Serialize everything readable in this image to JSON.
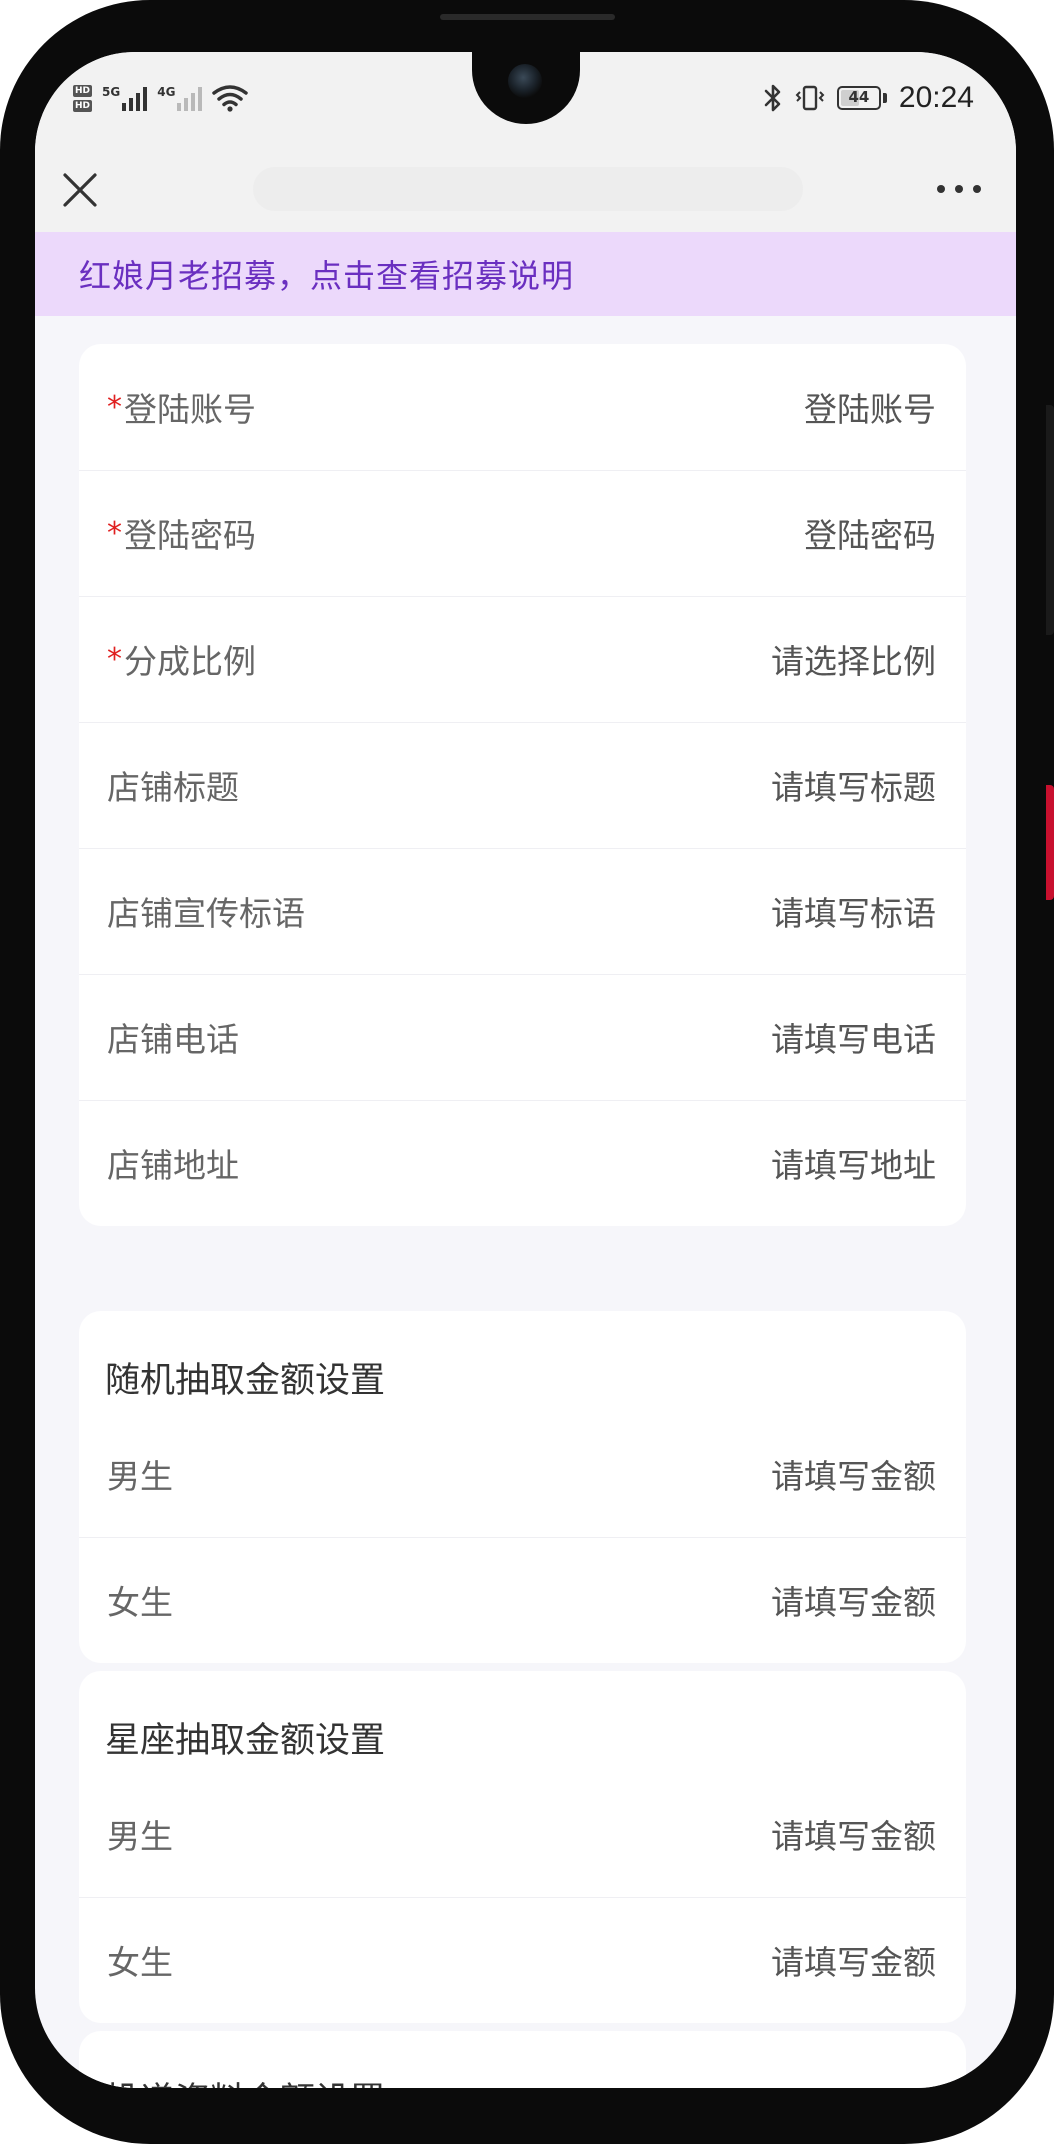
{
  "status_bar": {
    "network_1": "5G",
    "network_2": "4G",
    "hd_1": "HD",
    "hd_2": "HD",
    "battery_level": "44",
    "time": "20:24"
  },
  "nav": {
    "close_icon": "close-icon",
    "more_icon": "more-dots-icon"
  },
  "banner": {
    "text": "红娘月老招募，点击查看招募说明",
    "bg_color": "#ecd9fb",
    "text_color": "#6a2fc0"
  },
  "form": {
    "rows": [
      {
        "label": "登陆账号",
        "placeholder": "登陆账号",
        "required": "*"
      },
      {
        "label": "登陆密码",
        "placeholder": "登陆密码",
        "required": "*"
      },
      {
        "label": "分成比例",
        "placeholder": "请选择比例",
        "required": "*"
      },
      {
        "label": "店铺标题",
        "placeholder": "请填写标题"
      },
      {
        "label": "店铺宣传标语",
        "placeholder": "请填写标语"
      },
      {
        "label": "店铺电话",
        "placeholder": "请填写电话"
      },
      {
        "label": "店铺地址",
        "placeholder": "请填写地址"
      }
    ]
  },
  "random_section": {
    "title": "随机抽取金额设置",
    "rows": [
      {
        "label": "男生",
        "placeholder": "请填写金额"
      },
      {
        "label": "女生",
        "placeholder": "请填写金额"
      }
    ]
  },
  "zodiac_section": {
    "title": "星座抽取金额设置",
    "rows": [
      {
        "label": "男生",
        "placeholder": "请填写金额"
      },
      {
        "label": "女生",
        "placeholder": "请填写金额"
      }
    ]
  },
  "delivery_section": {
    "title": "投递资料金额设置"
  }
}
